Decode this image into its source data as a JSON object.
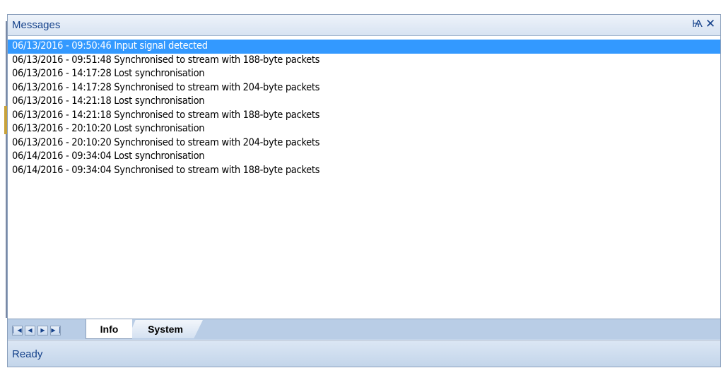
{
  "panel": {
    "title": "Messages",
    "pin_icon": "pin-icon",
    "close_icon": "close-icon",
    "pin_glyph": "Ѩ",
    "close_glyph": "✕"
  },
  "messages": [
    "06/13/2016 - 09:50:46 Input signal detected",
    "06/13/2016 - 09:51:48 Synchronised to stream with 188-byte packets",
    "06/13/2016 - 14:17:28 Lost synchronisation",
    "06/13/2016 - 14:17:28 Synchronised to stream with 204-byte packets",
    "06/13/2016 - 14:21:18 Lost synchronisation",
    "06/13/2016 - 14:21:18 Synchronised to stream with 188-byte packets",
    "06/13/2016 - 20:10:20 Lost synchronisation",
    "06/13/2016 - 20:10:20 Synchronised to stream with 204-byte packets",
    "06/14/2016 - 09:34:04 Lost synchronisation",
    "06/14/2016 - 09:34:04 Synchronised to stream with 188-byte packets"
  ],
  "selected_index": 0,
  "tab_nav": {
    "first": "▏◀",
    "prev": "◀",
    "next": "▶",
    "last": "▶▕"
  },
  "tabs": [
    {
      "label": "Info",
      "active": true
    },
    {
      "label": "System",
      "active": false
    }
  ],
  "status": {
    "text": "Ready"
  },
  "colors": {
    "selection": "#3399ff",
    "title_text": "#15428b",
    "tab_strip": "#b9cde6"
  }
}
